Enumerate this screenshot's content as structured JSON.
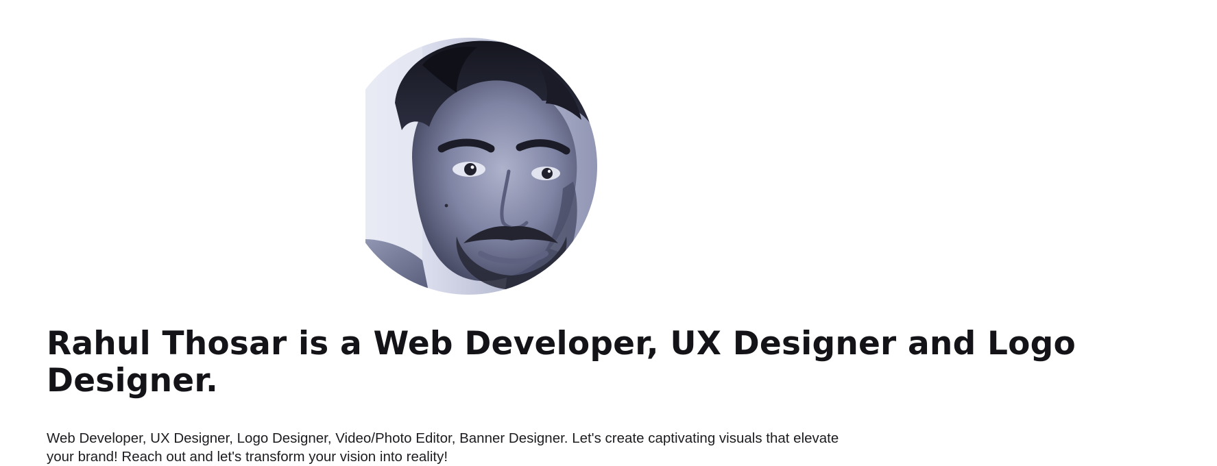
{
  "profile": {
    "avatar_icon": "profile-photo",
    "headline": "Rahul Thosar is a Web Developer, UX Designer and Logo Designer.",
    "bio": "Web Developer, UX Designer, Logo Designer, Video/Photo Editor, Banner Designer. Let's create captivating visuals that elevate your brand! Reach out and let's transform your vision into reality!"
  },
  "colors": {
    "background": "#ffffff",
    "text": "#141418",
    "photo_tint": "#8e93b3"
  }
}
